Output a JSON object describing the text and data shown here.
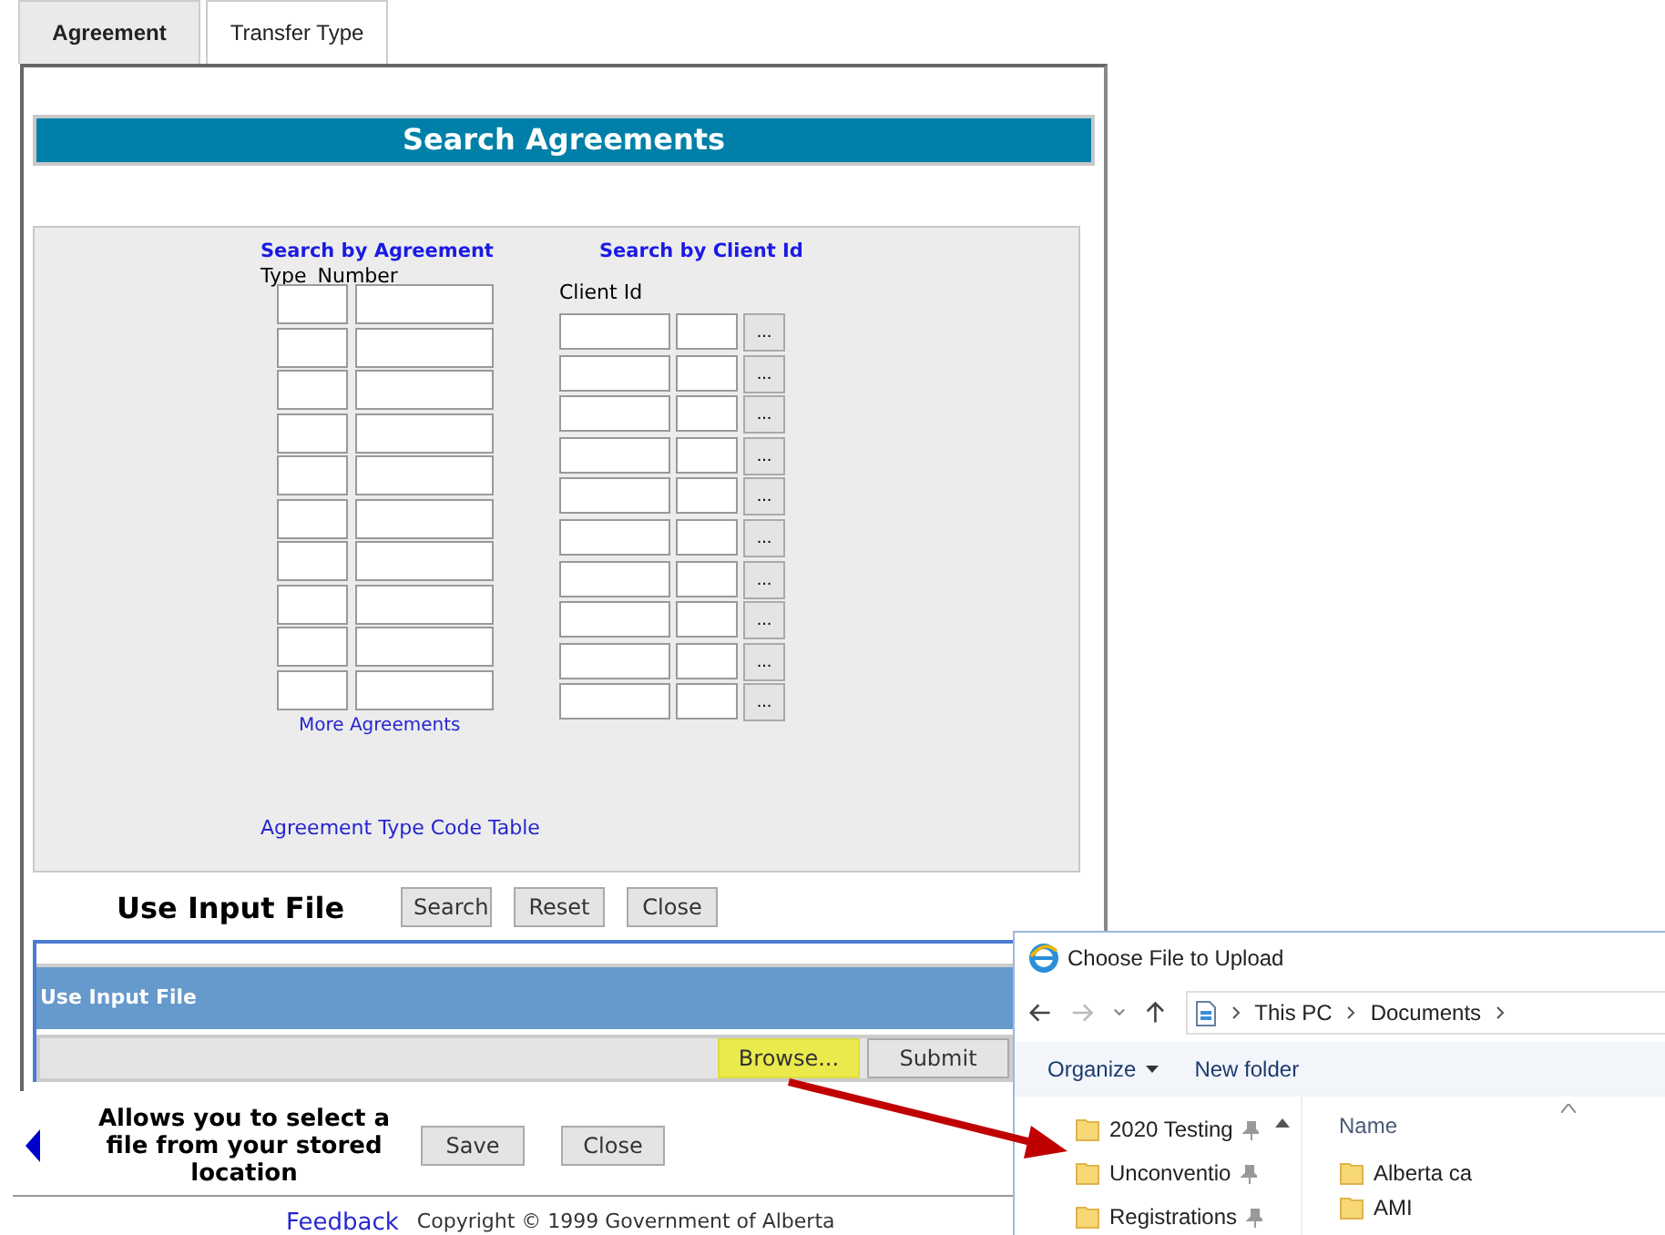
{
  "tabs": [
    {
      "label": "Agreement",
      "selected": true
    },
    {
      "label": "Transfer Type",
      "selected": false
    }
  ],
  "title": "Search Agreements",
  "agreement_search": {
    "heading": "Search by Agreement",
    "column_labels": [
      "Type",
      "Number"
    ],
    "link": "More Agreements"
  },
  "client_search": {
    "heading": "Search by Client Id",
    "label": "Client Id",
    "lookup_buttons": [
      "...",
      "...",
      "...",
      "...",
      "...",
      "...",
      "...",
      "...",
      "...",
      "..."
    ]
  },
  "code_table_link": "Agreement Type Code Table",
  "callout_heading": "Use Input File",
  "form_buttons": [
    "Search",
    "Reset",
    "Close"
  ],
  "input_file": {
    "header": "Use Input File",
    "buttons": [
      {
        "label": "Browse...",
        "highlighted": true
      },
      {
        "label": "Submit",
        "highlighted": false
      }
    ]
  },
  "callout_note": "Allows you to select a file from your stored location",
  "bottom_buttons": [
    "Save",
    "Close"
  ],
  "footer": {
    "link": "Feedback",
    "copyright": "Copyright © 1999 Government of Alberta"
  },
  "dialog": {
    "title": "Choose File to Upload",
    "breadcrumb": [
      "This PC",
      "Documents"
    ],
    "toolbar": [
      "Organize",
      "New folder"
    ],
    "nav_items": [
      {
        "label": "2020 Testing",
        "pinned": true
      },
      {
        "label": "Unconventio",
        "pinned": true
      },
      {
        "label": "Registrations",
        "pinned": true
      }
    ],
    "column": "Name",
    "files": [
      "Alberta ca",
      "AMI"
    ]
  }
}
